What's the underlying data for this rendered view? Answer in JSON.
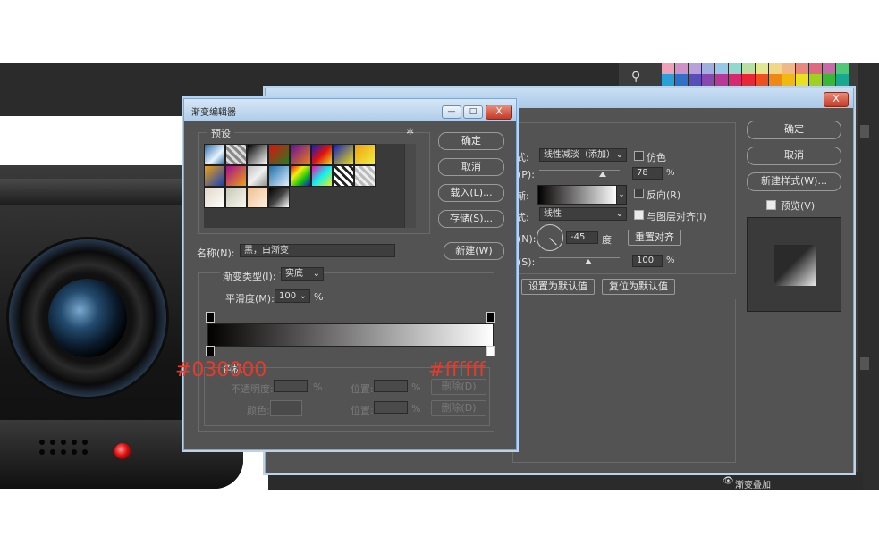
{
  "gradient_editor": {
    "title": "渐变编辑器",
    "window_buttons": [
      "—",
      "□",
      "X"
    ],
    "presets_label": "预设",
    "buttons": {
      "ok": "确定",
      "cancel": "取消",
      "load": "载入(L)...",
      "save": "存储(S)...",
      "new": "新建(W)"
    },
    "name_label": "名称(N):",
    "name_value": "黑，白渐变",
    "gradient_type_label": "渐变类型(I):",
    "gradient_type_value": "实底",
    "smoothness_label": "平滑度(M):",
    "smoothness_value": "100",
    "smoothness_unit": "%",
    "stops_label": "色标",
    "opacity_label": "不透明度:",
    "color_label": "颜色:",
    "location_label": "位置:",
    "percent": "%",
    "delete_label": "删除(D)",
    "gear_icon": "gear-icon",
    "colors": {
      "start": "#030000",
      "end": "#ffffff"
    }
  },
  "annotations": {
    "start_hex": "#030000",
    "end_hex": "#ffffff",
    "color": "#e83a2a"
  },
  "layer_style": {
    "close": "X",
    "blend_mode_label": "式:",
    "blend_mode_value": "线性减淡（添加）",
    "dither_label": "仿色",
    "opacity_label": "(P):",
    "opacity_value": "78",
    "gradient_label": "渐:",
    "reverse_label": "反向(R)",
    "style_label": "式:",
    "style_value": "线性",
    "align_label": "与图层对齐(I)",
    "angle_label": "(N):",
    "angle_value": "-45",
    "angle_unit": "度",
    "reset_align": "重置对齐",
    "scale_label": "(S):",
    "scale_value": "100",
    "percent": "%",
    "set_default": "设置为默认值",
    "reset_default": "复位为默认值",
    "buttons": {
      "ok": "确定",
      "cancel": "取消",
      "new_style": "新建样式(W)...",
      "preview": "预览(V)"
    }
  },
  "layers_panel": {
    "item": "渐变叠加"
  }
}
